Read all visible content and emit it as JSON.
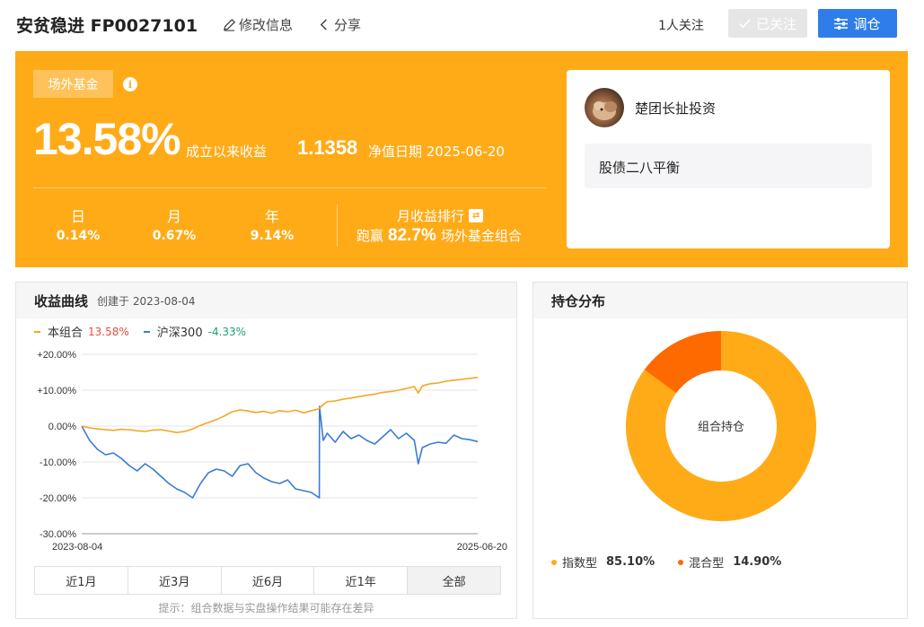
{
  "header": {
    "title": "安贫稳进 FP0027101",
    "edit_label": "修改信息",
    "share_label": "分享",
    "followers": "1人关注",
    "followed_label": "已关注",
    "adjust_label": "调仓"
  },
  "banner": {
    "tag": "场外基金",
    "return_value": "13.58%",
    "return_label": "成立以来收益",
    "nav_value": "1.1358",
    "nav_date_label": "净值日期 2025-06-20",
    "periods": [
      {
        "label": "日",
        "value": "0.14%"
      },
      {
        "label": "月",
        "value": "0.67%"
      },
      {
        "label": "年",
        "value": "9.14%"
      }
    ],
    "rank_title": "月收益排行",
    "rank_prefix": "跑赢",
    "rank_value": "82.7%",
    "rank_suffix": "场外基金组合",
    "author": "楚团长扯投资",
    "strategy": "股债二八平衡"
  },
  "colors": {
    "accent": "#ffab18",
    "primary_button": "#2f7dea",
    "series_portfolio": "#f5a623",
    "series_index": "#3a7bd5",
    "positive": "#e84c3d",
    "negative": "#1aa06e",
    "holding_index": "#ffab18",
    "holding_mixed": "#ff6a00"
  },
  "curve_panel": {
    "title": "收益曲线",
    "created": "创建于 2023-08-04",
    "legend": [
      {
        "name": "本组合",
        "value": "13.58%"
      },
      {
        "name": "沪深300",
        "value": "-4.33%"
      }
    ],
    "tabs": [
      "近1月",
      "近3月",
      "近6月",
      "近1年",
      "全部"
    ],
    "active_tab": "全部",
    "hint": "提示：组合数据与实盘操作结果可能存在差异"
  },
  "holding_panel": {
    "title": "持仓分布",
    "center_label": "组合持仓"
  },
  "chart_data": [
    {
      "type": "line",
      "ylim": [
        -30,
        20
      ],
      "yticks": [
        "+20.00%",
        "+10.00%",
        "0.00%",
        "-10.00%",
        "-20.00%",
        "-30.00%"
      ],
      "x_start_label": "2023-08-04",
      "x_end_label": "2025-06-20",
      "x": [
        0,
        0.02,
        0.04,
        0.06,
        0.08,
        0.1,
        0.12,
        0.14,
        0.16,
        0.18,
        0.2,
        0.22,
        0.24,
        0.26,
        0.28,
        0.3,
        0.32,
        0.34,
        0.36,
        0.38,
        0.4,
        0.42,
        0.44,
        0.46,
        0.48,
        0.5,
        0.52,
        0.54,
        0.56,
        0.58,
        0.6,
        0.6005,
        0.61,
        0.62,
        0.64,
        0.66,
        0.68,
        0.7,
        0.72,
        0.74,
        0.76,
        0.78,
        0.8,
        0.82,
        0.84,
        0.85,
        0.86,
        0.88,
        0.9,
        0.92,
        0.94,
        0.96,
        0.98,
        1.0
      ],
      "series": [
        {
          "name": "本组合",
          "values": [
            0,
            -0.5,
            -0.8,
            -1.0,
            -1.2,
            -0.9,
            -1.0,
            -1.3,
            -1.5,
            -1.1,
            -1.0,
            -1.4,
            -1.8,
            -1.5,
            -0.8,
            0.2,
            1.0,
            1.8,
            2.8,
            4.0,
            4.5,
            4.2,
            3.8,
            4.1,
            3.6,
            4.3,
            4.0,
            4.4,
            3.7,
            4.3,
            4.8,
            5.0,
            6.0,
            6.8,
            7.0,
            7.5,
            7.8,
            8.2,
            8.6,
            8.9,
            9.4,
            9.6,
            10.0,
            10.5,
            11.0,
            9.2,
            11.2,
            11.8,
            12.0,
            12.5,
            12.8,
            13.0,
            13.3,
            13.58
          ]
        },
        {
          "name": "沪深300",
          "values": [
            0,
            -4.0,
            -6.5,
            -8.0,
            -7.5,
            -9.0,
            -11.0,
            -12.5,
            -10.5,
            -12.0,
            -14.0,
            -16.0,
            -17.5,
            -18.5,
            -20.0,
            -16.0,
            -13.0,
            -12.0,
            -12.5,
            -14.0,
            -11.0,
            -10.5,
            -13.0,
            -14.5,
            -15.5,
            -16.0,
            -15.0,
            -17.5,
            -18.0,
            -18.5,
            -20.0,
            5.5,
            -4.0,
            -2.0,
            -4.5,
            -1.5,
            -3.5,
            -2.5,
            -4.0,
            -5.0,
            -3.0,
            -1.0,
            -3.5,
            -2.0,
            -4.0,
            -10.5,
            -6.0,
            -5.0,
            -4.5,
            -4.8,
            -2.5,
            -3.5,
            -3.8,
            -4.33
          ]
        }
      ]
    },
    {
      "type": "pie",
      "categories": [
        "指数型",
        "混合型"
      ],
      "values": [
        85.1,
        14.9
      ],
      "labels": [
        "85.10%",
        "14.90%"
      ]
    }
  ]
}
